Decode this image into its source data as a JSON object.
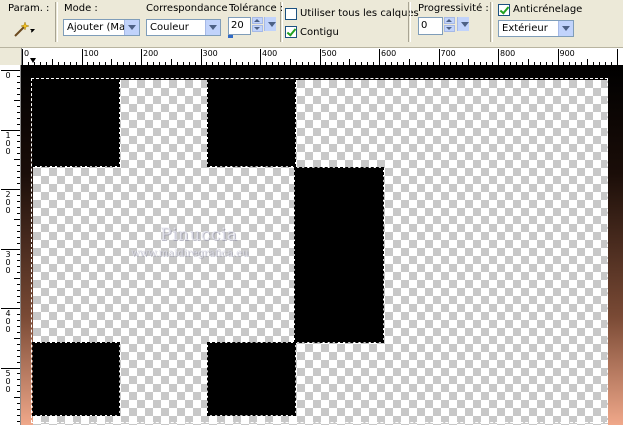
{
  "toolbar": {
    "param_label": "Param. :",
    "mode_label": "Mode :",
    "mode_value": "Ajouter (Maj)",
    "match_label": "Correspondance :",
    "match_value": "Couleur",
    "tolerance_label": "Tolérance :",
    "tolerance_value": "20",
    "use_all_layers_label": "Utiliser tous les calques",
    "use_all_layers_checked": false,
    "contiguous_label": "Contigu",
    "contiguous_checked": true,
    "feather_label": "Progressivité :",
    "feather_value": "0",
    "antialias_label": "Anticrénelage",
    "antialias_checked": true,
    "antialias_mode": "Extérieur"
  },
  "ruler_h": [
    "0",
    "100",
    "200",
    "300",
    "400",
    "500",
    "600",
    "700",
    "800",
    "900"
  ],
  "ruler_v": [
    [
      "0"
    ],
    [
      "1",
      "0",
      "0"
    ],
    [
      "2",
      "0",
      "0"
    ],
    [
      "3",
      "0",
      "0"
    ],
    [
      "4",
      "0",
      "0"
    ],
    [
      "5",
      "0",
      "0"
    ]
  ],
  "watermark": {
    "name": "Pinuccia",
    "url": "www.maidiregrafica.eu"
  },
  "colors": {
    "accent": "#316ac5",
    "check_green": "#21a121",
    "gradient_top": "#000000",
    "gradient_bottom": "#f0a88a"
  }
}
